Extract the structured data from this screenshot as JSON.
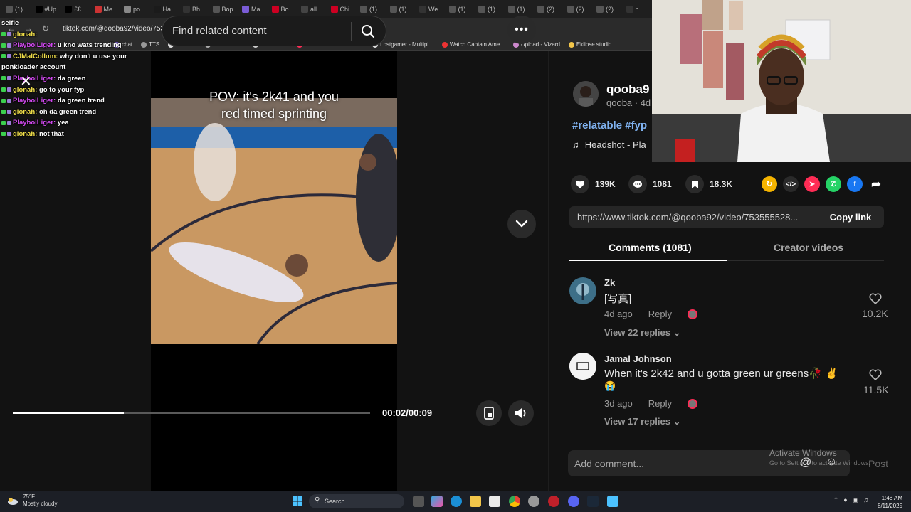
{
  "browser": {
    "tabs": [
      "(1)",
      "#Up",
      "££",
      "Me",
      "po",
      "Ha",
      "Bh",
      "Bop",
      "Ma",
      "Bo",
      "all",
      "Chi",
      "(1)",
      "(1)",
      "We",
      "(1)",
      "(1)",
      "(1)",
      "(2)",
      "(2)",
      "(2)",
      "h"
    ],
    "url": "tiktok.com/@qooba92/video/7535552808688386697q=2k%20timing&t=1754891308763",
    "bookmarks": [
      "chat",
      "TTS",
      "streams",
      "nba streams",
      "nfl streams",
      "Pink FRIDAYY W KPI...",
      "Lostgamer - Multipl...",
      "Watch Captain Ame...",
      "Upload - Vizard",
      "Eklipse studio"
    ]
  },
  "chat": {
    "lines": [
      {
        "user": "selfie",
        "msg": "",
        "color": "#ffffff"
      },
      {
        "user": "glonah:",
        "msg": "",
        "color": "#f2e04a"
      },
      {
        "user": "PlayboiLiger:",
        "msg": "u kno wats trending",
        "color": "#d64bf5"
      },
      {
        "user": "CJMalCollum:",
        "msg": "why don't u use your",
        "color": "#f2e04a"
      },
      {
        "user": "",
        "msg": "ponkloader account",
        "color": "#ffffff"
      },
      {
        "user": "PlayboiLiger:",
        "msg": "da green",
        "color": "#d64bf5"
      },
      {
        "user": "glonah:",
        "msg": "go to your fyp",
        "color": "#f2e04a"
      },
      {
        "user": "PlayboiLiger:",
        "msg": "da green trend",
        "color": "#d64bf5"
      },
      {
        "user": "glonah:",
        "msg": "oh da green trend",
        "color": "#f2e04a"
      },
      {
        "user": "PlayboiLiger:",
        "msg": "yea",
        "color": "#d64bf5"
      },
      {
        "user": "glonah:",
        "msg": "not that",
        "color": "#f2e04a"
      }
    ]
  },
  "search": {
    "placeholder": "Find related content"
  },
  "video": {
    "caption_line1": "POV: it's 2k41 and you",
    "caption_line2": "red timed sprinting",
    "time": "00:02/00:09",
    "progress": 0.31
  },
  "author": {
    "name": "qooba9",
    "sub": "qooba · 4d",
    "hashtags": "#relatable #fyp",
    "music_icon": "♫",
    "music": "Headshot - Pla"
  },
  "stats": {
    "likes": "139K",
    "comments": "1081",
    "saves": "18.3K"
  },
  "link": {
    "url": "https://www.tiktok.com/@qooba92/video/753555528...",
    "copy": "Copy link"
  },
  "tabs": {
    "comments": "Comments (1081)",
    "creator": "Creator videos"
  },
  "comments": [
    {
      "name": "Zk",
      "text": "[写真]",
      "date": "4d ago",
      "reply": "Reply",
      "replies": "View 22 replies",
      "likes": "10.2K"
    },
    {
      "name": "Jamal Johnson",
      "text": "When it's 2k42 and u gotta green ur greens🥀 ✌️",
      "text2": "😭",
      "date": "3d ago",
      "reply": "Reply",
      "replies": "View 17 replies",
      "likes": "11.5K"
    }
  ],
  "addcomment": {
    "placeholder": "Add comment...",
    "post": "Post"
  },
  "windows": {
    "activate": "Activate Windows",
    "activate_sub": "Go to Settings to activate Windows.",
    "weather_temp": "75°F",
    "weather_desc": "Mostly cloudy",
    "search": "Search",
    "time": "1:48 AM",
    "date": "8/11/2025"
  },
  "colors": {
    "accent_blue": "#7fb2f0",
    "bg": "#121212",
    "progress": "#ffffff"
  }
}
